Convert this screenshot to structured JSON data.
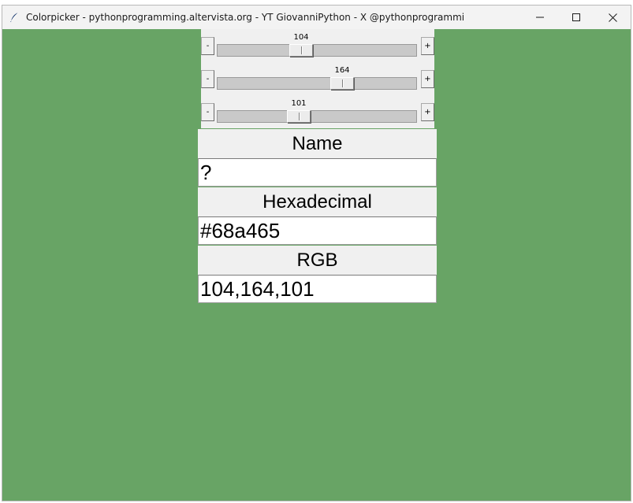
{
  "window": {
    "title": "Colorpicker - pythonprogramming.altervista.org - YT GiovanniPython - X @pythonprogrammi",
    "background_color": "#68a465"
  },
  "sliders": [
    {
      "channel": "red",
      "value": "104",
      "minus_label": "-",
      "plus_label": "+",
      "level": 0.408
    },
    {
      "channel": "green",
      "value": "164",
      "minus_label": "-",
      "plus_label": "+",
      "level": 0.643
    },
    {
      "channel": "blue",
      "value": "101",
      "minus_label": "-",
      "plus_label": "+",
      "level": 0.396
    }
  ],
  "info": {
    "name_label": "Name",
    "name_value": "?",
    "hex_label": "Hexadecimal",
    "hex_value": "#68a465",
    "rgb_label": "RGB",
    "rgb_value": "104,164,101"
  },
  "colors": {
    "titlebar": "#f3f3f3",
    "trough": "#c9c9c9",
    "panel": "#f0f0f0"
  },
  "icons": {
    "app": "feather-icon",
    "minimize": "minimize-icon",
    "maximize": "maximize-icon",
    "close": "close-icon"
  }
}
